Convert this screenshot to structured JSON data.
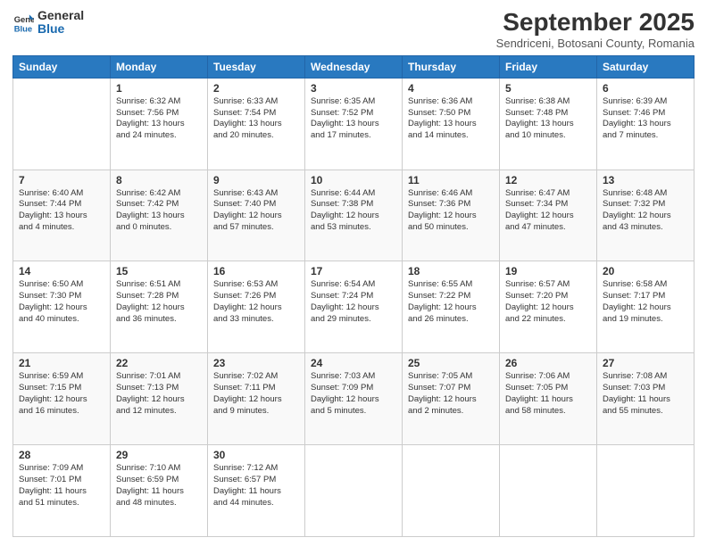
{
  "logo": {
    "general": "General",
    "blue": "Blue"
  },
  "title": "September 2025",
  "subtitle": "Sendriceni, Botosani County, Romania",
  "days_of_week": [
    "Sunday",
    "Monday",
    "Tuesday",
    "Wednesday",
    "Thursday",
    "Friday",
    "Saturday"
  ],
  "weeks": [
    [
      {
        "day": "",
        "info": ""
      },
      {
        "day": "1",
        "info": "Sunrise: 6:32 AM\nSunset: 7:56 PM\nDaylight: 13 hours\nand 24 minutes."
      },
      {
        "day": "2",
        "info": "Sunrise: 6:33 AM\nSunset: 7:54 PM\nDaylight: 13 hours\nand 20 minutes."
      },
      {
        "day": "3",
        "info": "Sunrise: 6:35 AM\nSunset: 7:52 PM\nDaylight: 13 hours\nand 17 minutes."
      },
      {
        "day": "4",
        "info": "Sunrise: 6:36 AM\nSunset: 7:50 PM\nDaylight: 13 hours\nand 14 minutes."
      },
      {
        "day": "5",
        "info": "Sunrise: 6:38 AM\nSunset: 7:48 PM\nDaylight: 13 hours\nand 10 minutes."
      },
      {
        "day": "6",
        "info": "Sunrise: 6:39 AM\nSunset: 7:46 PM\nDaylight: 13 hours\nand 7 minutes."
      }
    ],
    [
      {
        "day": "7",
        "info": "Sunrise: 6:40 AM\nSunset: 7:44 PM\nDaylight: 13 hours\nand 4 minutes."
      },
      {
        "day": "8",
        "info": "Sunrise: 6:42 AM\nSunset: 7:42 PM\nDaylight: 13 hours\nand 0 minutes."
      },
      {
        "day": "9",
        "info": "Sunrise: 6:43 AM\nSunset: 7:40 PM\nDaylight: 12 hours\nand 57 minutes."
      },
      {
        "day": "10",
        "info": "Sunrise: 6:44 AM\nSunset: 7:38 PM\nDaylight: 12 hours\nand 53 minutes."
      },
      {
        "day": "11",
        "info": "Sunrise: 6:46 AM\nSunset: 7:36 PM\nDaylight: 12 hours\nand 50 minutes."
      },
      {
        "day": "12",
        "info": "Sunrise: 6:47 AM\nSunset: 7:34 PM\nDaylight: 12 hours\nand 47 minutes."
      },
      {
        "day": "13",
        "info": "Sunrise: 6:48 AM\nSunset: 7:32 PM\nDaylight: 12 hours\nand 43 minutes."
      }
    ],
    [
      {
        "day": "14",
        "info": "Sunrise: 6:50 AM\nSunset: 7:30 PM\nDaylight: 12 hours\nand 40 minutes."
      },
      {
        "day": "15",
        "info": "Sunrise: 6:51 AM\nSunset: 7:28 PM\nDaylight: 12 hours\nand 36 minutes."
      },
      {
        "day": "16",
        "info": "Sunrise: 6:53 AM\nSunset: 7:26 PM\nDaylight: 12 hours\nand 33 minutes."
      },
      {
        "day": "17",
        "info": "Sunrise: 6:54 AM\nSunset: 7:24 PM\nDaylight: 12 hours\nand 29 minutes."
      },
      {
        "day": "18",
        "info": "Sunrise: 6:55 AM\nSunset: 7:22 PM\nDaylight: 12 hours\nand 26 minutes."
      },
      {
        "day": "19",
        "info": "Sunrise: 6:57 AM\nSunset: 7:20 PM\nDaylight: 12 hours\nand 22 minutes."
      },
      {
        "day": "20",
        "info": "Sunrise: 6:58 AM\nSunset: 7:17 PM\nDaylight: 12 hours\nand 19 minutes."
      }
    ],
    [
      {
        "day": "21",
        "info": "Sunrise: 6:59 AM\nSunset: 7:15 PM\nDaylight: 12 hours\nand 16 minutes."
      },
      {
        "day": "22",
        "info": "Sunrise: 7:01 AM\nSunset: 7:13 PM\nDaylight: 12 hours\nand 12 minutes."
      },
      {
        "day": "23",
        "info": "Sunrise: 7:02 AM\nSunset: 7:11 PM\nDaylight: 12 hours\nand 9 minutes."
      },
      {
        "day": "24",
        "info": "Sunrise: 7:03 AM\nSunset: 7:09 PM\nDaylight: 12 hours\nand 5 minutes."
      },
      {
        "day": "25",
        "info": "Sunrise: 7:05 AM\nSunset: 7:07 PM\nDaylight: 12 hours\nand 2 minutes."
      },
      {
        "day": "26",
        "info": "Sunrise: 7:06 AM\nSunset: 7:05 PM\nDaylight: 11 hours\nand 58 minutes."
      },
      {
        "day": "27",
        "info": "Sunrise: 7:08 AM\nSunset: 7:03 PM\nDaylight: 11 hours\nand 55 minutes."
      }
    ],
    [
      {
        "day": "28",
        "info": "Sunrise: 7:09 AM\nSunset: 7:01 PM\nDaylight: 11 hours\nand 51 minutes."
      },
      {
        "day": "29",
        "info": "Sunrise: 7:10 AM\nSunset: 6:59 PM\nDaylight: 11 hours\nand 48 minutes."
      },
      {
        "day": "30",
        "info": "Sunrise: 7:12 AM\nSunset: 6:57 PM\nDaylight: 11 hours\nand 44 minutes."
      },
      {
        "day": "",
        "info": ""
      },
      {
        "day": "",
        "info": ""
      },
      {
        "day": "",
        "info": ""
      },
      {
        "day": "",
        "info": ""
      }
    ]
  ]
}
